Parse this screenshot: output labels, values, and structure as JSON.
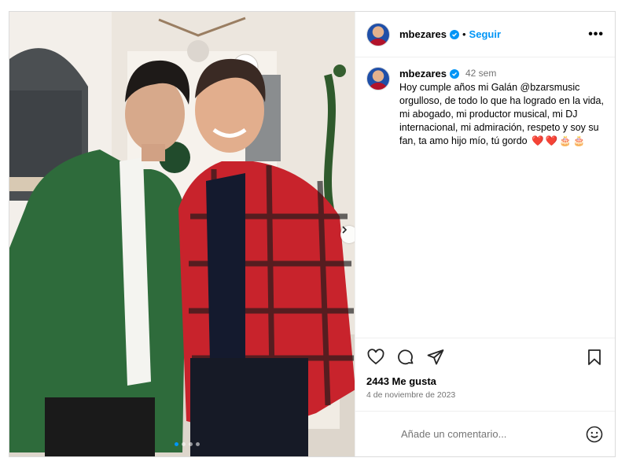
{
  "post": {
    "author": {
      "username": "mbezares",
      "follow_label": "Seguir",
      "separator": "•"
    },
    "more_label": "•••",
    "caption": {
      "username": "mbezares",
      "time": "42 sem",
      "text": "Hoy cumple años mi Galán @bzarsmusic orgulloso, de todo lo que ha logrado en la vida, mi abogado, mi productor musical, mi DJ internacional, mi admiración, respeto y soy su fan, ta amo hijo mío, tú gordo",
      "emojis": [
        "❤️",
        "❤️",
        "🎂",
        "🎂"
      ]
    },
    "likes": "2443 Me gusta",
    "date": "4 de noviembre de 2023",
    "comment_placeholder": "Añade un comentario...",
    "carousel": {
      "count": 4,
      "active": 0
    }
  },
  "icons": [
    "verified-badge-icon",
    "heart-icon",
    "comment-icon",
    "share-icon",
    "bookmark-icon",
    "emoji-icon",
    "chevron-right-icon",
    "more-icon"
  ],
  "colors": {
    "accent": "#0095f6",
    "muted": "#737373",
    "border": "#dbdbdb"
  }
}
